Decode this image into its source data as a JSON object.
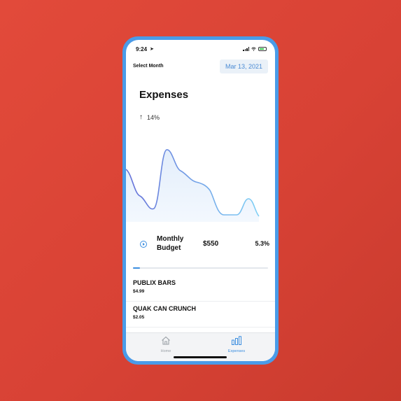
{
  "status": {
    "time": "9:24",
    "location_glyph": "➤",
    "icons": [
      "signal-icon",
      "wifi-icon",
      "battery-icon"
    ]
  },
  "header": {
    "select_month": "Select Month",
    "date": "Mar 13, 2021"
  },
  "main": {
    "title": "Expenses",
    "change": {
      "arrow": "↑",
      "value": "14%"
    },
    "chart": {
      "type": "area",
      "line_colors": [
        "#6670d8",
        "#7fd0f5"
      ],
      "fill_color": "#e6f1fc"
    }
  },
  "budget": {
    "label": "Monthly Budget",
    "amount": "$550",
    "percent": "5.3%",
    "progress": 0.053
  },
  "items": [
    {
      "name": "PUBLIX BARS",
      "price": "$4.99"
    },
    {
      "name": "QUAK CAN CRUNCH",
      "price": "$2.05"
    }
  ],
  "tabs": [
    {
      "label": "Home",
      "icon": "home-icon",
      "active": false
    },
    {
      "label": "Expenses",
      "icon": "bar-chart-icon",
      "active": true
    }
  ],
  "colors": {
    "background": "#d84235",
    "phone_frame": "#4a9be8",
    "accent": "#3b8ee0"
  }
}
